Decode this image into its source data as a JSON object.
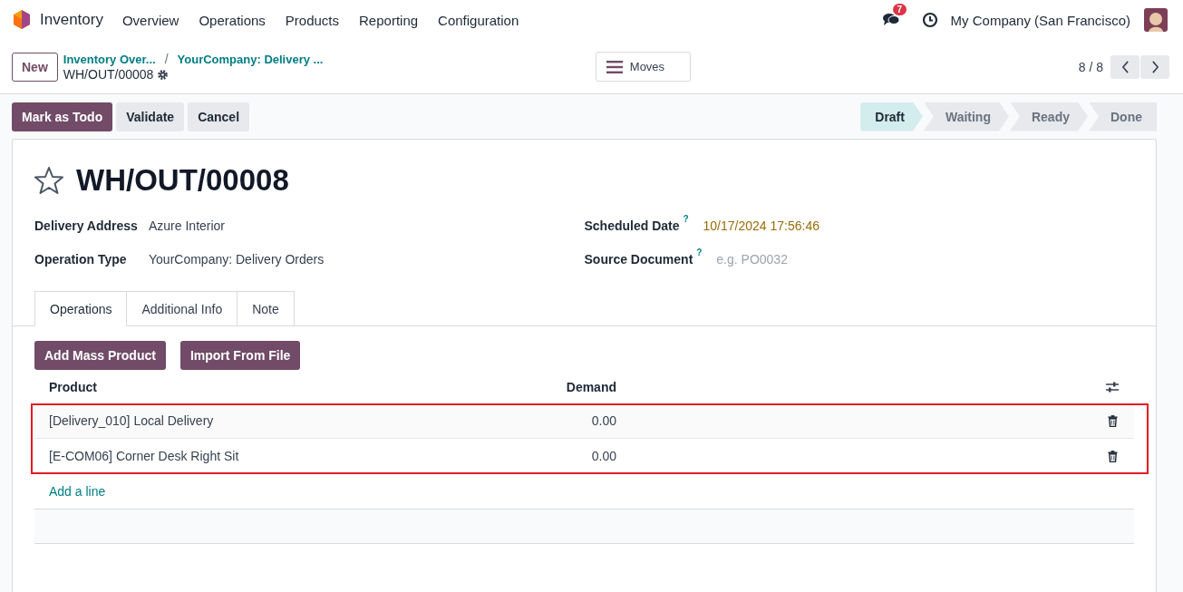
{
  "nav": {
    "app": "Inventory",
    "menu": [
      "Overview",
      "Operations",
      "Products",
      "Reporting",
      "Configuration"
    ],
    "messages_count": "7",
    "company": "My Company (San Francisco)"
  },
  "control_panel": {
    "new_button": "New",
    "breadcrumbs": [
      "Inventory Over...",
      "YourCompany: Delivery ..."
    ],
    "breadcrumb_separator": "/",
    "record": "WH/OUT/00008",
    "moves_button": "Moves",
    "pager": "8 / 8"
  },
  "actions": [
    {
      "label": "Mark as Todo",
      "primary": true
    },
    {
      "label": "Validate",
      "primary": false
    },
    {
      "label": "Cancel",
      "primary": false
    }
  ],
  "status_steps": [
    {
      "label": "Draft",
      "selected": true
    },
    {
      "label": "Waiting",
      "selected": false
    },
    {
      "label": "Ready",
      "selected": false
    },
    {
      "label": "Done",
      "selected": false
    }
  ],
  "form": {
    "title": "WH/OUT/00008",
    "left_fields": [
      {
        "label": "Delivery Address",
        "value": "Azure Interior"
      },
      {
        "label": "Operation Type",
        "value": "YourCompany: Delivery Orders"
      }
    ],
    "right_fields": [
      {
        "label": "Scheduled Date",
        "help": "?",
        "value": "10/17/2024 17:56:46"
      },
      {
        "label": "Source Document",
        "help": "?",
        "placeholder": "e.g. PO0032"
      }
    ]
  },
  "tabs": [
    {
      "label": "Operations",
      "selected": true
    },
    {
      "label": "Additional Info",
      "selected": false
    },
    {
      "label": "Note",
      "selected": false
    }
  ],
  "list_buttons": [
    "Add Mass Product",
    "Import From File"
  ],
  "table": {
    "columns": [
      "Product",
      "Demand"
    ],
    "rows": [
      {
        "product": "[Delivery_010] Local Delivery",
        "demand": "0.00"
      },
      {
        "product": "[E-COM06] Corner Desk Right Sit",
        "demand": "0.00"
      }
    ],
    "add_line": "Add a line"
  }
}
